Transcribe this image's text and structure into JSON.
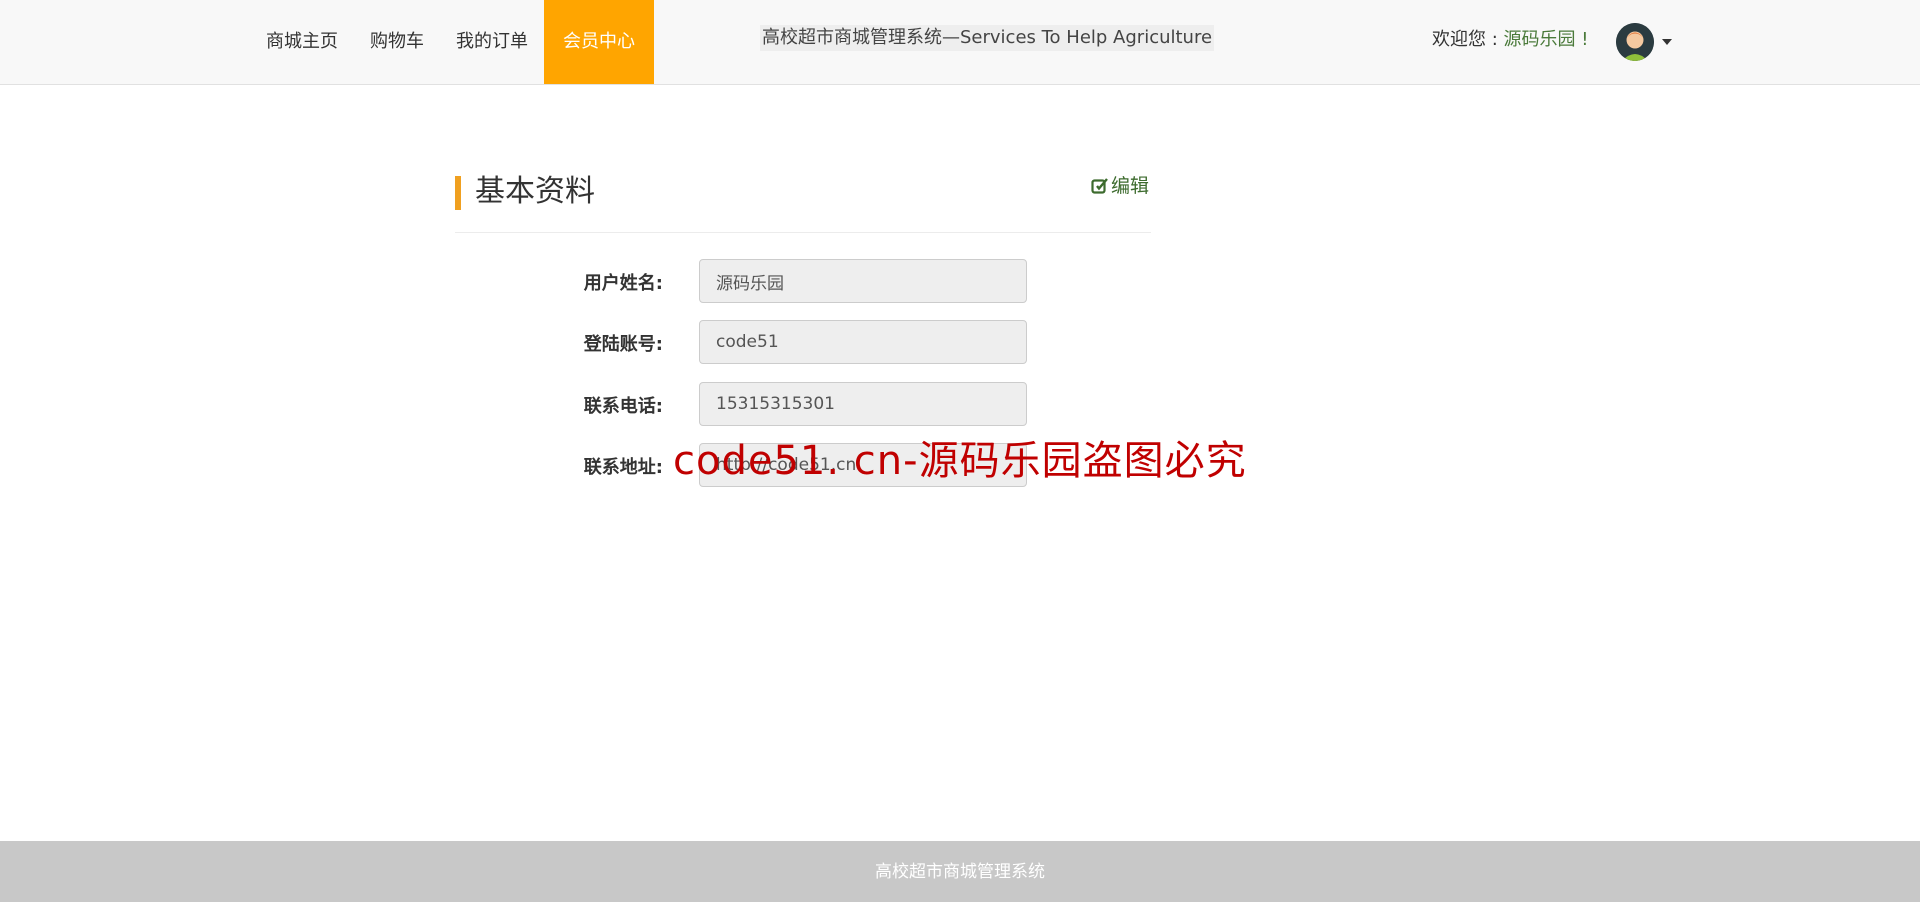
{
  "nav": {
    "items": [
      {
        "label": "商城主页",
        "active": false
      },
      {
        "label": "购物车",
        "active": false
      },
      {
        "label": "我的订单",
        "active": false
      },
      {
        "label": "会员中心",
        "active": true
      }
    ],
    "active_color": "#ffa500"
  },
  "header": {
    "system_title": "高校超市商城管理系统—Services To Help Agriculture",
    "welcome_prefix": "欢迎您 : ",
    "user_name": "源码乐园",
    "welcome_suffix": " !",
    "avatar_icon": "user-avatar-icon"
  },
  "panel": {
    "title": "基本资料",
    "edit_label": "编辑",
    "accent_color": "#f0a020",
    "fields": [
      {
        "label": "用户姓名:",
        "value": "源码乐园"
      },
      {
        "label": "登陆账号:",
        "value": "code51"
      },
      {
        "label": "联系电话:",
        "value": "15315315301"
      },
      {
        "label": "联系地址:",
        "value": "http://code51.cn"
      }
    ]
  },
  "watermark": "code51. cn-源码乐园盗图必究",
  "footer": {
    "text": "高校超市商城管理系统"
  }
}
